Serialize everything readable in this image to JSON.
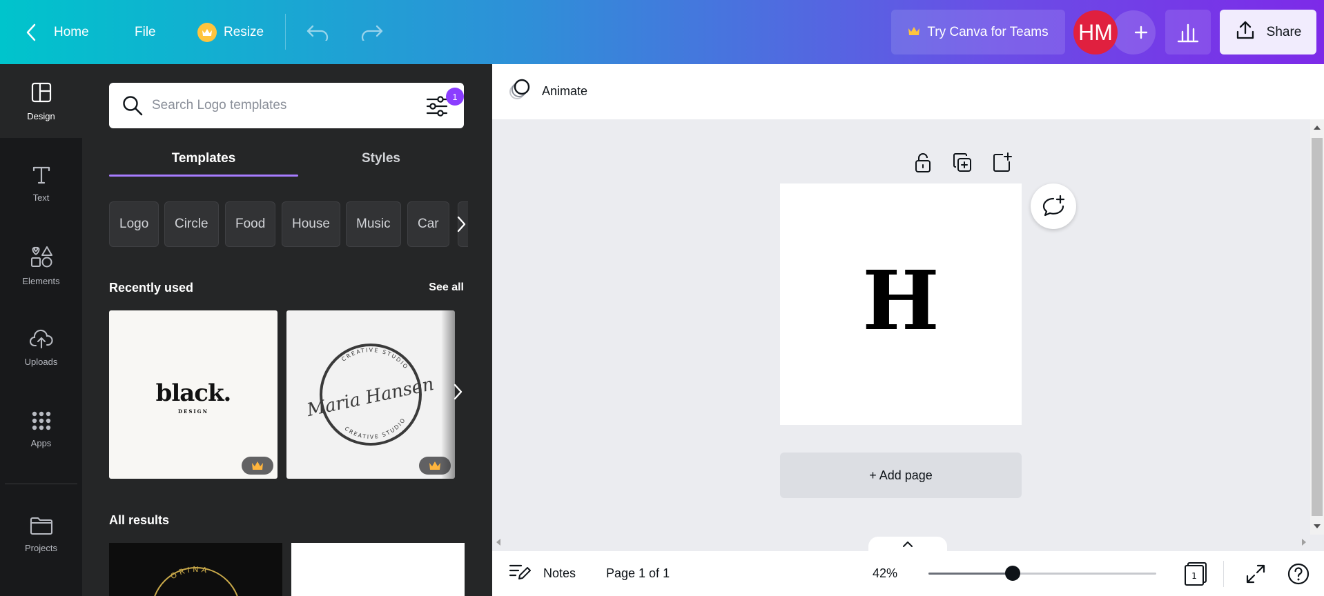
{
  "topbar": {
    "home": "Home",
    "file": "File",
    "resize": "Resize",
    "try_teams": "Try Canva for Teams",
    "avatar_initials": "HM",
    "share": "Share"
  },
  "rail": {
    "items": [
      {
        "label": "Design",
        "icon": "layout-icon",
        "active": true
      },
      {
        "label": "Text",
        "icon": "text-icon"
      },
      {
        "label": "Elements",
        "icon": "shapes-icon"
      },
      {
        "label": "Uploads",
        "icon": "cloud-upload-icon"
      },
      {
        "label": "Apps",
        "icon": "grid-icon"
      },
      {
        "label": "Projects",
        "icon": "folder-icon"
      }
    ]
  },
  "panel": {
    "search_placeholder": "Search Logo templates",
    "filter_count": "1",
    "tabs": [
      "Templates",
      "Styles"
    ],
    "chips": [
      "Logo",
      "Circle",
      "Food",
      "House",
      "Music",
      "Car"
    ],
    "recently_used_title": "Recently used",
    "see_all": "See all",
    "thumb1": {
      "title": "black.",
      "subtitle": "DESIGN"
    },
    "thumb2": {
      "script": "Maria Hansen",
      "ring_text": "CREATIVE STUDIO"
    },
    "all_results_title": "All results",
    "result1_text": "ORINA"
  },
  "editor": {
    "animate": "Animate",
    "page_letter": "H",
    "add_page": "+ Add page"
  },
  "footer": {
    "notes": "Notes",
    "page_info": "Page 1 of 1",
    "zoom": "42%",
    "zoom_level": 0.37,
    "page_count": "1"
  },
  "colors": {
    "accent": "#8b3dff",
    "panel_bg": "#252627",
    "rail_bg": "#18191b",
    "avatar": "#e0203f",
    "crown": "#ffc43d"
  }
}
